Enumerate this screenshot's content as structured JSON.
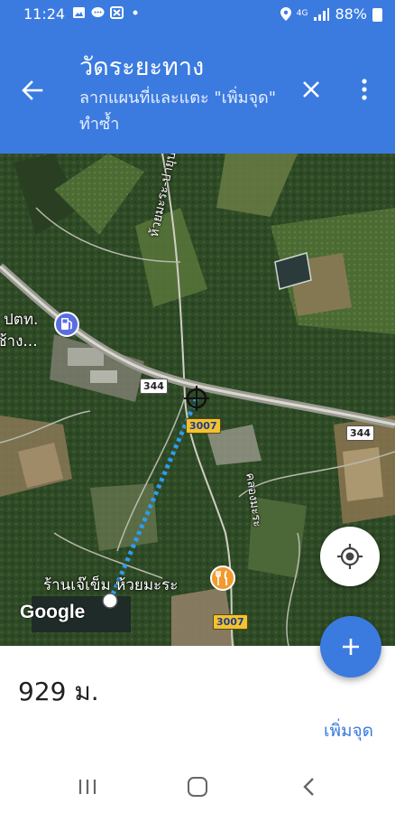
{
  "status_bar": {
    "time": "11:24",
    "network": "4G",
    "battery": "88%",
    "icons": [
      "gallery-icon",
      "line-chat-icon",
      "app-icon",
      "dot-icon",
      "location-icon",
      "signal-icon",
      "battery-icon"
    ]
  },
  "header": {
    "title": "วัดระยะทาง",
    "subtitle": "ลากแผนที่และแตะ \"เพิ่มจุด\" ทำซ้ำ",
    "icons": [
      "back-arrow-icon",
      "close-icon",
      "more-vert-icon"
    ]
  },
  "map": {
    "labels": {
      "road_name": "ห้วยมะระ-ปายุบ",
      "canal_name": "คลองมะระ",
      "station_name_1": "ปตท.",
      "station_name_2": "ช้าง...",
      "place_name": "ร้านเจ๊เข็ม ห้วยมะระ"
    },
    "shields": {
      "route_344_a": "344",
      "route_344_b": "344",
      "route_3007_a": "3007",
      "route_3007_b": "3007"
    },
    "attribution": "Google",
    "colors": {
      "measure_line": "#2e9cf0",
      "fuel_poi": "#5b6ee0",
      "food_poi": "#f29a2e"
    }
  },
  "bottom": {
    "distance": "929 ม.",
    "add_point": "เพิ่มจุด"
  },
  "colors": {
    "primary": "#3b7be0"
  }
}
